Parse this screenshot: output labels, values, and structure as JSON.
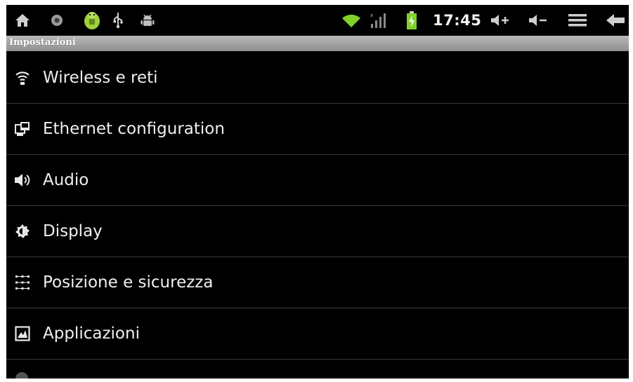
{
  "status_bar": {
    "left_icons": [
      "home-icon",
      "record-icon",
      "android-icon",
      "usb-icon",
      "android-debug-icon"
    ],
    "time": "17:45",
    "right_icons": [
      "wifi-icon",
      "signal-icon",
      "battery-charging-icon",
      "volume-up-icon",
      "volume-down-icon",
      "menu-icon",
      "back-icon"
    ],
    "colors": {
      "wifi": "#7fd12a",
      "battery": "#7fd12a",
      "android": "#9fcf3b"
    }
  },
  "title_bar": {
    "title": "Impostazioni"
  },
  "settings": {
    "items": [
      {
        "label": "Wireless e reti",
        "icon": "wifi-icon"
      },
      {
        "label": "Ethernet configuration",
        "icon": "ethernet-icon"
      },
      {
        "label": "Audio",
        "icon": "speaker-icon"
      },
      {
        "label": "Display",
        "icon": "brightness-icon"
      },
      {
        "label": "Posizione e sicurezza",
        "icon": "location-grid-icon"
      },
      {
        "label": "Applicazioni",
        "icon": "applications-icon"
      }
    ]
  }
}
